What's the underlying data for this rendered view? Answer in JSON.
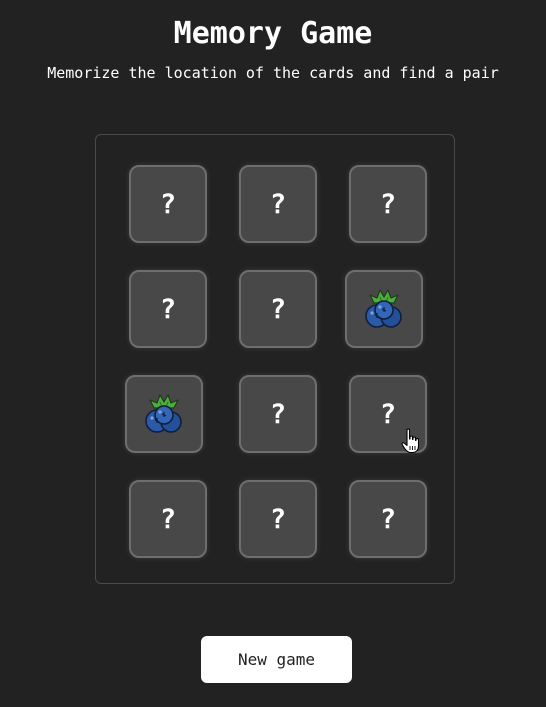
{
  "header": {
    "title": "Memory Game",
    "subtitle": "Memorize the location of the cards and find a pair"
  },
  "board": {
    "columns": 3,
    "rows": 4,
    "hidden_symbol": "?",
    "cards": [
      {
        "state": "hidden",
        "label": "?"
      },
      {
        "state": "hidden",
        "label": "?"
      },
      {
        "state": "hidden",
        "label": "?"
      },
      {
        "state": "hidden",
        "label": "?"
      },
      {
        "state": "hidden",
        "label": "?"
      },
      {
        "state": "revealed",
        "content": "blueberry-icon"
      },
      {
        "state": "revealed",
        "content": "blueberry-icon"
      },
      {
        "state": "hidden",
        "label": "?"
      },
      {
        "state": "hidden",
        "label": "?"
      },
      {
        "state": "hidden",
        "label": "?"
      },
      {
        "state": "hidden",
        "label": "?"
      },
      {
        "state": "hidden",
        "label": "?"
      }
    ]
  },
  "controls": {
    "new_game_label": "New game"
  },
  "colors": {
    "background": "#222222",
    "card_face": "#484848",
    "card_border": "#6e6e6e",
    "button_bg": "#ffffff",
    "berry": "#2a5aa8",
    "leaf": "#4cae3c"
  }
}
